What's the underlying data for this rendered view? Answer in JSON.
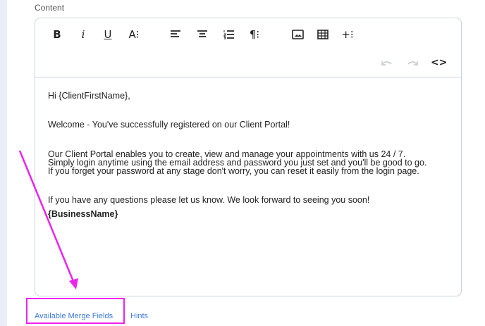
{
  "section_label": "Content",
  "toolbar": {
    "bold": "B",
    "italic": "i",
    "underline": "U",
    "font_size": "A⁝",
    "align_left_icon": "align-left-icon",
    "align_center_icon": "align-center-icon",
    "list_icon": "ordered-list-icon",
    "paragraph": "¶⁝",
    "image_icon": "image-icon",
    "table_icon": "table-icon",
    "insert_more": "+⁝",
    "undo_icon": "undo-icon",
    "redo_icon": "redo-icon",
    "code_view": "<>"
  },
  "email_body": {
    "greeting": "Hi {ClientFirstName},",
    "welcome": "Welcome - You've successfully registered on our Client Portal!",
    "portal_line1": "Our Client Portal enables you to create, view and manage your appointments with us 24 / 7.",
    "portal_line2": "Simply login anytime using the email address and password you just set and you'll be good to go.",
    "portal_line3": "If you forget your password at any stage don't worry, you can reset it easily from the login page.",
    "questions": "If you have any questions please let us know. We look forward to seeing you soon!",
    "business_name": "{BusinessName}"
  },
  "footer_links": {
    "merge_fields": "Available Merge Fields",
    "hints": "Hints"
  },
  "colors": {
    "annotation": "#ee22ee",
    "link": "#3c7ad8",
    "border": "#c8d1e2"
  }
}
